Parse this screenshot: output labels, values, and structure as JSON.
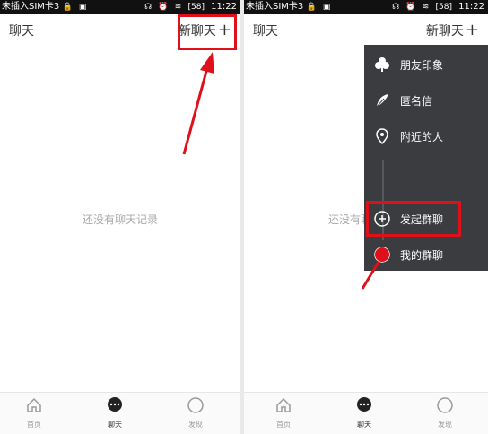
{
  "status_bar": {
    "carrier": "未插入SIM卡3",
    "time": "11:22",
    "battery": "58"
  },
  "left": {
    "header": {
      "title": "聊天",
      "new_chat": "新聊天",
      "plus": "+"
    },
    "empty_text": "还没有聊天记录",
    "tabs": [
      {
        "label": "首页",
        "icon": "home-icon"
      },
      {
        "label": "聊天",
        "icon": "chat-bubble-icon"
      },
      {
        "label": "发现",
        "icon": "compass-icon"
      }
    ]
  },
  "right": {
    "header": {
      "title": "聊天",
      "new_chat": "新聊天",
      "plus": "+"
    },
    "empty_text": "还没有聊天记录",
    "menu": [
      {
        "label": "朋友印象",
        "icon": "clover-icon"
      },
      {
        "label": "匿名信",
        "icon": "feather-icon"
      },
      {
        "label": "附近的人",
        "icon": "location-pin-icon"
      },
      {
        "label": "发起群聊",
        "icon": "plus-circle-icon"
      },
      {
        "label": "我的群聊",
        "icon": "group-icon"
      }
    ],
    "tabs": [
      {
        "label": "首页",
        "icon": "home-icon"
      },
      {
        "label": "聊天",
        "icon": "chat-bubble-icon"
      },
      {
        "label": "发现",
        "icon": "compass-icon"
      }
    ]
  },
  "colors": {
    "highlight": "#e0101a",
    "menu_bg": "#3a3c3f"
  }
}
